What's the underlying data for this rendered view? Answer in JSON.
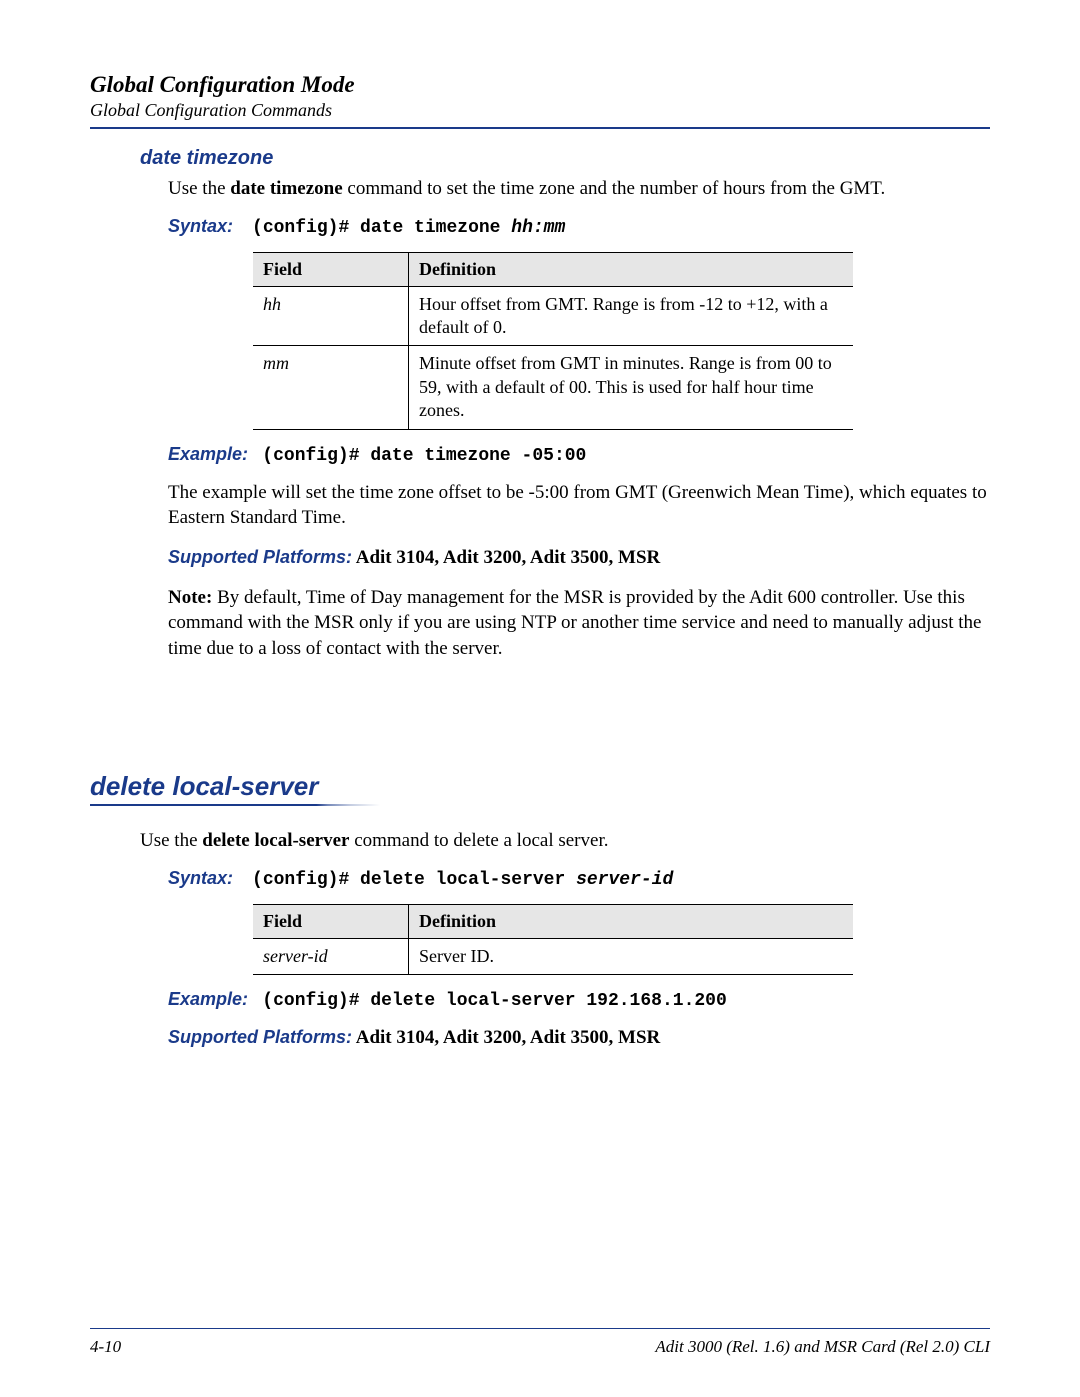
{
  "header": {
    "title": "Global Configuration Mode",
    "subtitle": "Global Configuration Commands"
  },
  "sec1": {
    "heading": "date timezone",
    "intro_pre": "Use the ",
    "intro_bold": "date timezone",
    "intro_post": " command to set the time zone and the number of hours from the GMT.",
    "syntax_label": "Syntax:",
    "syntax_cmd": "(config)# date timezone ",
    "syntax_arg": "hh:mm",
    "table": {
      "col_field": "Field",
      "col_def": "Definition",
      "rows": [
        {
          "field": "hh",
          "def": "Hour offset from GMT. Range is from -12 to +12, with a default of 0."
        },
        {
          "field": "mm",
          "def": "Minute offset from GMT in minutes. Range is from 00 to 59, with a default of 00. This is used for half hour time zones."
        }
      ]
    },
    "example_label": "Example:",
    "example_cmd": "(config)# date timezone -05:00",
    "example_text": "The example will set the time zone offset to be -5:00 from GMT (Greenwich Mean Time), which equates to Eastern Standard Time.",
    "platforms_label": "Supported Platforms:",
    "platforms_value": " Adit 3104, Adit 3200, Adit 3500, MSR",
    "note_label": "Note:  ",
    "note_text": "By default, Time of Day management for the MSR is provided by the Adit 600 controller. Use this command with the MSR only if you are using NTP or another time service and need to manually adjust the time due to a loss of contact with the server."
  },
  "sec2": {
    "heading": "delete local-server",
    "intro_pre": "Use the ",
    "intro_bold": "delete local-server",
    "intro_post": " command to delete a local server.",
    "syntax_label": "Syntax:",
    "syntax_cmd": "(config)# delete local-server ",
    "syntax_arg": "server-id",
    "table": {
      "col_field": "Field",
      "col_def": "Definition",
      "rows": [
        {
          "field": "server-id",
          "def": "Server ID."
        }
      ]
    },
    "example_label": "Example:",
    "example_cmd": "(config)# delete local-server 192.168.1.200",
    "platforms_label": "Supported Platforms:",
    "platforms_value": " Adit 3104, Adit 3200, Adit 3500, MSR"
  },
  "footer": {
    "left": "4-10",
    "right": "Adit 3000 (Rel. 1.6) and MSR Card (Rel 2.0) CLI"
  }
}
